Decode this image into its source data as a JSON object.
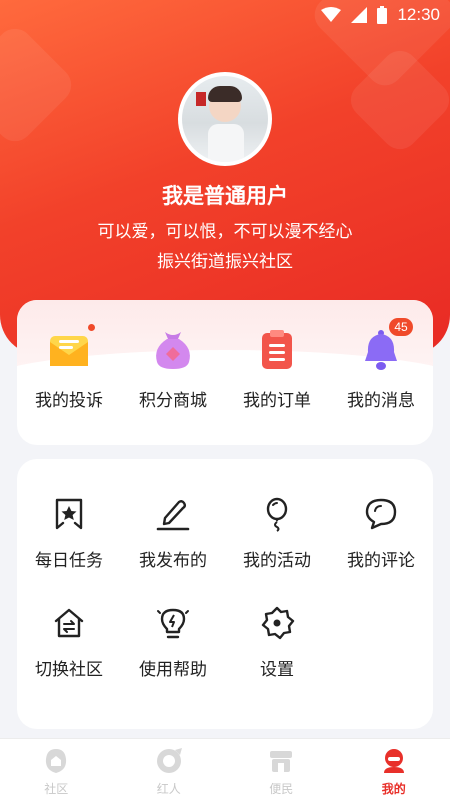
{
  "status_bar": {
    "time": "12:30"
  },
  "profile": {
    "name": "我是普通用户",
    "motto": "可以爱，可以恨，不可以漫不经心",
    "community": "振兴街道振兴社区"
  },
  "quick_actions": [
    {
      "label": "我的投诉",
      "icon": "complaint-mail-icon"
    },
    {
      "label": "积分商城",
      "icon": "points-bag-icon"
    },
    {
      "label": "我的订单",
      "icon": "order-clipboard-icon"
    },
    {
      "label": "我的消息",
      "icon": "bell-icon",
      "badge": "45"
    }
  ],
  "menu": [
    {
      "label": "每日任务",
      "icon": "star-bookmark-icon"
    },
    {
      "label": "我发布的",
      "icon": "edit-pen-icon"
    },
    {
      "label": "我的活动",
      "icon": "balloon-icon"
    },
    {
      "label": "我的评论",
      "icon": "comment-bubble-icon"
    },
    {
      "label": "切换社区",
      "icon": "switch-home-icon"
    },
    {
      "label": "使用帮助",
      "icon": "lightbulb-icon"
    },
    {
      "label": "设置",
      "icon": "gear-icon"
    }
  ],
  "tabs": [
    {
      "label": "社区",
      "icon": "community-icon"
    },
    {
      "label": "红人",
      "icon": "star-person-icon"
    },
    {
      "label": "便民",
      "icon": "shop-icon"
    },
    {
      "label": "我的",
      "icon": "profile-icon",
      "active": true
    }
  ],
  "colors": {
    "accent": "#e8302a",
    "badge": "#f04a2a"
  }
}
